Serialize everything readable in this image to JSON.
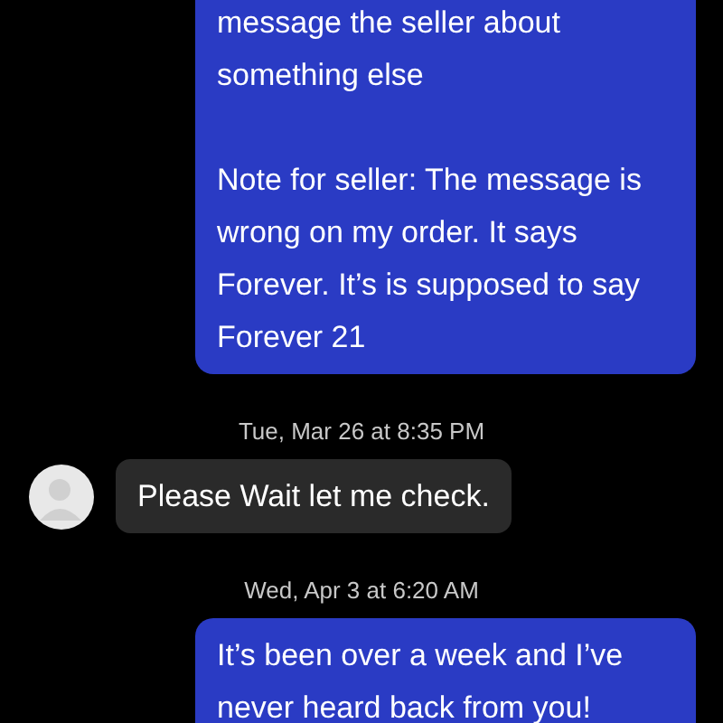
{
  "messages": [
    {
      "kind": "outgoing",
      "paragraphs": [
        "message the seller about something else",
        "Note for seller: The message is wrong on my order. It says Forever. It’s is supposed to say Forever 21"
      ]
    },
    {
      "kind": "timestamp",
      "text": "Tue, Mar 26 at 8:35 PM"
    },
    {
      "kind": "incoming",
      "paragraphs": [
        "Please Wait let me check."
      ]
    },
    {
      "kind": "timestamp",
      "text": "Wed, Apr 3 at 6:20 AM"
    },
    {
      "kind": "outgoing",
      "paragraphs": [
        "It’s been over a week and I’ve never heard back from you!"
      ]
    }
  ]
}
